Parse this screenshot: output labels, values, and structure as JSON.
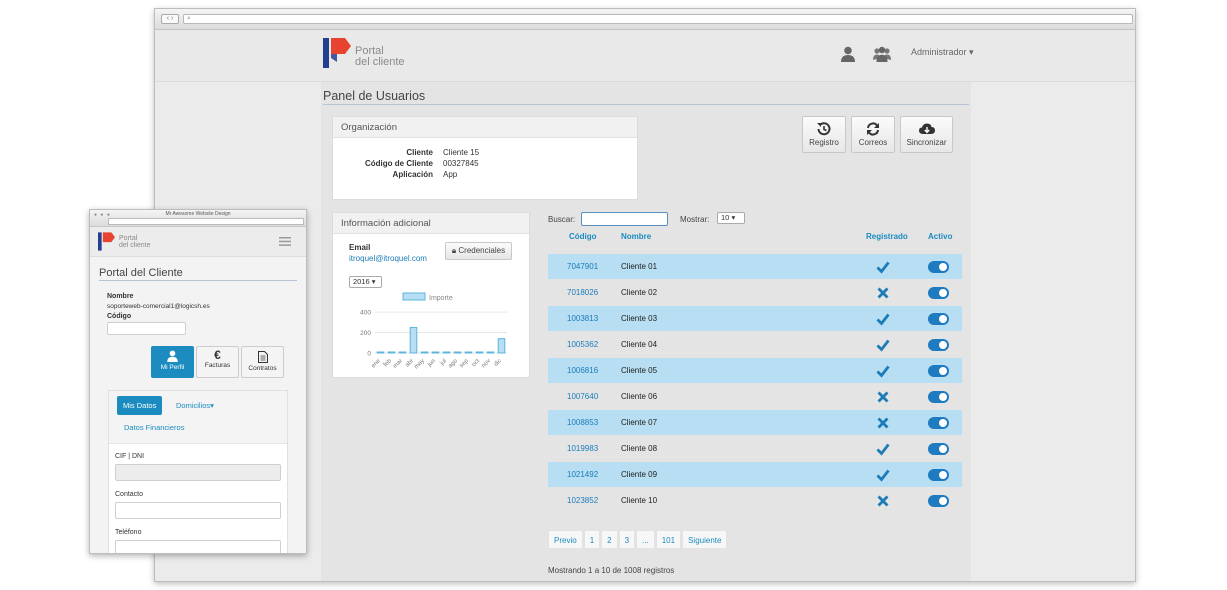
{
  "desktop": {
    "header": {
      "logo_line1": "Portal",
      "logo_line2": "del cliente",
      "user_menu": "Administrador"
    },
    "page_title": "Panel de Usuarios",
    "organizacion": {
      "title": "Organización",
      "rows": [
        {
          "label": "Cliente",
          "value": "Cliente 15"
        },
        {
          "label": "Código de Cliente",
          "value": "00327845"
        },
        {
          "label": "Aplicación",
          "value": "App"
        }
      ]
    },
    "toolbar": {
      "registro": "Registro",
      "correos": "Correos",
      "sincronizar": "Sincronizar"
    },
    "info": {
      "title": "Información adicional",
      "email_label": "Email",
      "email_value": "itroquel@itroquel.com",
      "credenciales": "Credenciales",
      "year": "2016"
    },
    "chart_data": {
      "type": "bar",
      "legend": "Importe",
      "categories": [
        "ene",
        "feb",
        "mar",
        "abr",
        "may",
        "jun",
        "jul",
        "ago",
        "sep",
        "oct",
        "nov",
        "dic"
      ],
      "values": [
        0,
        0,
        0,
        250,
        0,
        0,
        0,
        0,
        0,
        0,
        0,
        140
      ],
      "yticks": [
        "400",
        "200",
        "0"
      ],
      "ylim": [
        0,
        450
      ]
    },
    "table": {
      "search_label": "Buscar:",
      "show_label": "Mostrar:",
      "show_value": "10",
      "headers": {
        "codigo": "Código",
        "nombre": "Nombre",
        "registrado": "Registrado",
        "activo": "Activo"
      },
      "rows": [
        {
          "code": "7047901",
          "name": "Cliente 01",
          "registered": true
        },
        {
          "code": "7018026",
          "name": "Cliente 02",
          "registered": false
        },
        {
          "code": "1003813",
          "name": "Cliente 03",
          "registered": true
        },
        {
          "code": "1005362",
          "name": "Cliente 04",
          "registered": true
        },
        {
          "code": "1006816",
          "name": "Cliente 05",
          "registered": true
        },
        {
          "code": "1007640",
          "name": "Cliente 06",
          "registered": false
        },
        {
          "code": "1008853",
          "name": "Cliente 07",
          "registered": false
        },
        {
          "code": "1019983",
          "name": "Cliente 08",
          "registered": true
        },
        {
          "code": "1021492",
          "name": "Cliente 09",
          "registered": true
        },
        {
          "code": "1023852",
          "name": "Cliente 10",
          "registered": false
        }
      ],
      "pagination": [
        "Previo",
        "1",
        "2",
        "3",
        "...",
        "101",
        "Siguiente"
      ],
      "showing": "Mostrando 1 a 10 de 1008 registros"
    }
  },
  "mobile": {
    "window_title": "Mr Awesome Website Design",
    "logo_line1": "Portal",
    "logo_line2": "del cliente",
    "page_title": "Portal del Cliente",
    "nombre_label": "Nombre",
    "nombre_value": "soporteweb-comercial1@logicsh.es",
    "codigo_label": "Código",
    "buttons": {
      "perfil": "Mi Perfil",
      "facturas": "Facturas",
      "contratos": "Contratos"
    },
    "tabs": {
      "mis_datos": "Mis Datos",
      "domicilios": "Domicilios",
      "financieros": "Datos Financieros"
    },
    "fields": {
      "cif": "CIF | DNI",
      "contacto": "Contacto",
      "telefono": "Teléfono"
    }
  },
  "colors": {
    "accent": "#1b8bc0",
    "row_highlight": "#b7def2",
    "toggle": "#1e7bc0",
    "logo_red": "#e8432e",
    "logo_blue": "#233f8f"
  }
}
